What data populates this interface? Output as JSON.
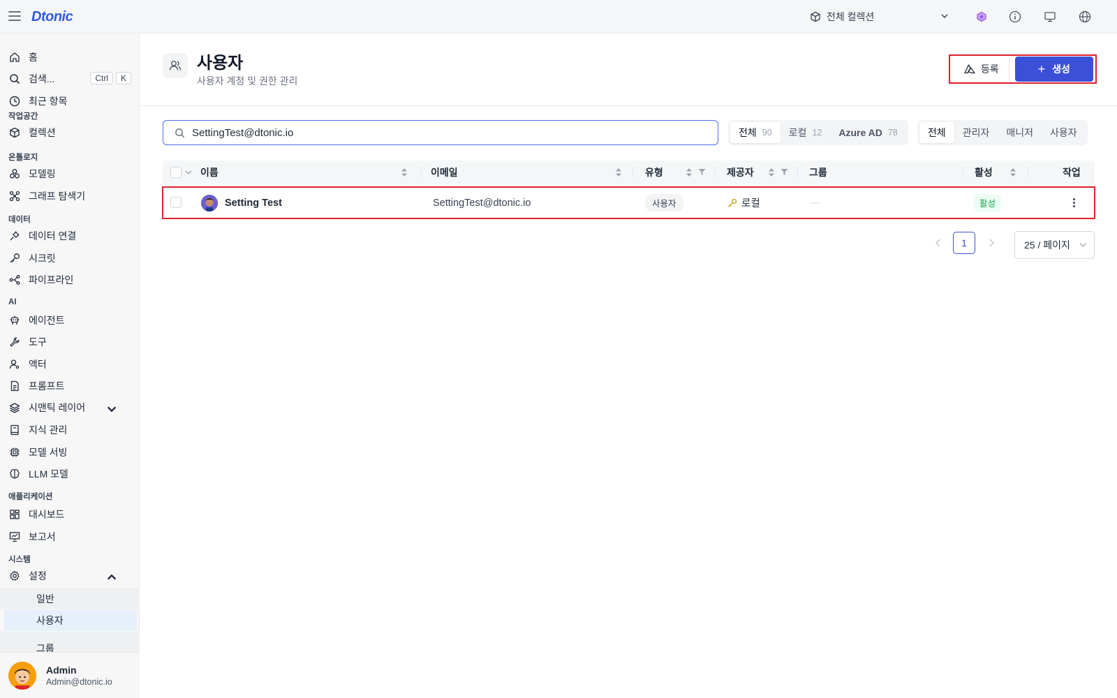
{
  "app": {
    "logo": "Dtonic"
  },
  "topbar": {
    "collection_label": "전체 컬렉션"
  },
  "sidebar": {
    "items": [
      {
        "label": "홈",
        "icon": "home-icon"
      },
      {
        "label": "검색...",
        "icon": "search-icon",
        "shortcut": [
          "Ctrl",
          "K"
        ]
      },
      {
        "label": "최근 항목",
        "icon": "clock-icon"
      }
    ],
    "sections": [
      {
        "title": "작업공간",
        "items": [
          {
            "label": "컬렉션",
            "icon": "cube-icon"
          }
        ]
      },
      {
        "title": "온톨로지",
        "items": [
          {
            "label": "모델링",
            "icon": "modeling-icon"
          },
          {
            "label": "그래프 탐색기",
            "icon": "graph-icon"
          }
        ]
      },
      {
        "title": "데이터",
        "items": [
          {
            "label": "데이터 연결",
            "icon": "plug-icon"
          },
          {
            "label": "시크릿",
            "icon": "key-icon"
          },
          {
            "label": "파이프라인",
            "icon": "pipeline-icon"
          }
        ]
      },
      {
        "title": "AI",
        "items": [
          {
            "label": "에이전트",
            "icon": "robot-icon"
          },
          {
            "label": "도구",
            "icon": "wrench-icon"
          },
          {
            "label": "액터",
            "icon": "actor-icon"
          },
          {
            "label": "프롬프트",
            "icon": "document-icon"
          },
          {
            "label": "시맨틱 레이어",
            "icon": "layers-icon"
          },
          {
            "label": "지식 관리",
            "icon": "book-icon"
          },
          {
            "label": "모델 서빙",
            "icon": "chip-icon"
          },
          {
            "label": "LLM 모델",
            "icon": "brain-icon"
          }
        ]
      },
      {
        "title": "애플리케이션",
        "items": [
          {
            "label": "대시보드",
            "icon": "dashboard-icon"
          },
          {
            "label": "보고서",
            "icon": "report-icon"
          }
        ]
      },
      {
        "title": "시스템",
        "items": [
          {
            "label": "설정",
            "icon": "gear-icon"
          }
        ]
      }
    ],
    "settings_sub": [
      "일반",
      "사용자",
      "그룹"
    ],
    "footer": {
      "name": "Admin",
      "email": "Admin@dtonic.io"
    }
  },
  "header": {
    "title": "사용자",
    "subtitle": "사용자 계정 및 권한 관리",
    "register_label": "등록",
    "create_label": "생성"
  },
  "search": {
    "value": "SettingTest@dtonic.io"
  },
  "provider_filter": [
    {
      "label": "전체",
      "count": "90"
    },
    {
      "label": "로컬",
      "count": "12"
    },
    {
      "label": "Azure AD",
      "count": "78"
    }
  ],
  "role_filter": [
    "전체",
    "관리자",
    "매니저",
    "사용자"
  ],
  "table": {
    "columns": [
      "이름",
      "이메일",
      "유형",
      "제공자",
      "그룹",
      "활성",
      "작업"
    ],
    "rows": [
      {
        "name": "Setting Test",
        "email": "SettingTest@dtonic.io",
        "type": "사용자",
        "provider": "로컬",
        "group": "—",
        "status": "활성"
      }
    ]
  },
  "pagination": {
    "current": "1",
    "page_size": "25 / 페이지"
  },
  "colors": {
    "primary": "#3b4fd8",
    "highlight": "#e11d2a",
    "success": "#16a34a"
  }
}
